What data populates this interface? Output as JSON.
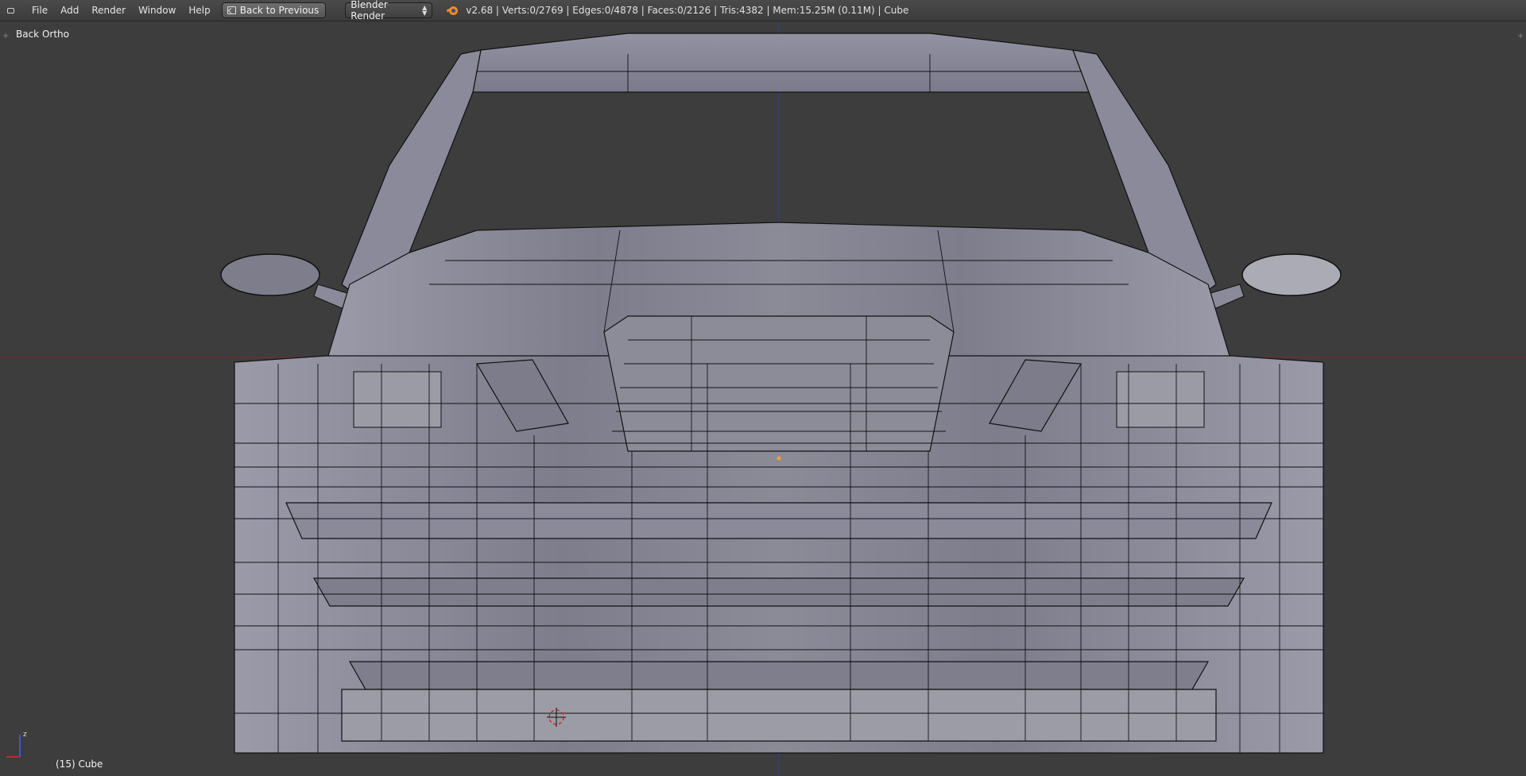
{
  "menu": {
    "items": [
      {
        "id": "file",
        "label": "File"
      },
      {
        "id": "add",
        "label": "Add"
      },
      {
        "id": "render",
        "label": "Render"
      },
      {
        "id": "window",
        "label": "Window"
      },
      {
        "id": "help",
        "label": "Help"
      }
    ],
    "back_button": "Back to Previous",
    "render_engine": "Blender Render"
  },
  "stats": "v2.68 | Verts:0/2769 | Edges:0/4878 | Faces:0/2126 | Tris:4382 | Mem:15.25M (0.11M) | Cube",
  "viewport": {
    "view_name": "Back Ortho",
    "object_label": "(15) Cube"
  },
  "colors": {
    "background": "#3d3d3d",
    "mesh_fill": "#8e8e9c",
    "mesh_wire": "#0f0f12",
    "x_axis": "#8a2a2a",
    "z_axis": "#2f3f9a"
  }
}
